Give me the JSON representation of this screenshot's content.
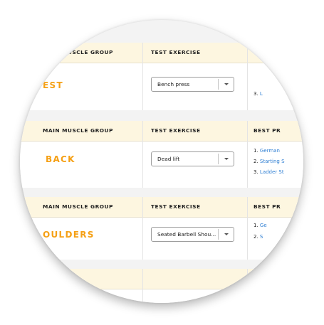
{
  "headers": {
    "group": "MAIN MUSCLE GROUP",
    "exercise": "TEST EXERCISE",
    "programs": "BEST PR"
  },
  "rows": [
    {
      "group": "EST",
      "header_exercise": "TEST EXERCISE",
      "exercise": "Bench press",
      "programs": [
        {
          "num": "3.",
          "label": "L"
        }
      ]
    },
    {
      "group": "BACK",
      "header_group": "MAIN MUSCLE GROUP",
      "header_exercise": "TEST EXERCISE",
      "header_programs": "BEST PR",
      "exercise": "Dead lift",
      "programs": [
        {
          "num": "1.",
          "label": "German"
        },
        {
          "num": "2.",
          "label": "Starting S"
        },
        {
          "num": "3.",
          "label": "Ladder St"
        }
      ]
    },
    {
      "group": "OULDERS",
      "header_group": "MAIN MUSCLE GROUP",
      "header_exercise": "TEST EXERCISE",
      "header_programs": "BEST PR",
      "exercise": "Seated Barbell Shou...",
      "programs": [
        {
          "num": "1.",
          "label": "Ge"
        },
        {
          "num": "2.",
          "label": "S"
        }
      ]
    }
  ],
  "colors": {
    "accent": "#f5a015",
    "link": "#2f7fd3",
    "header_bg": "#fdf6e0"
  },
  "icons": {
    "dropdown": "chevron-down-icon"
  }
}
